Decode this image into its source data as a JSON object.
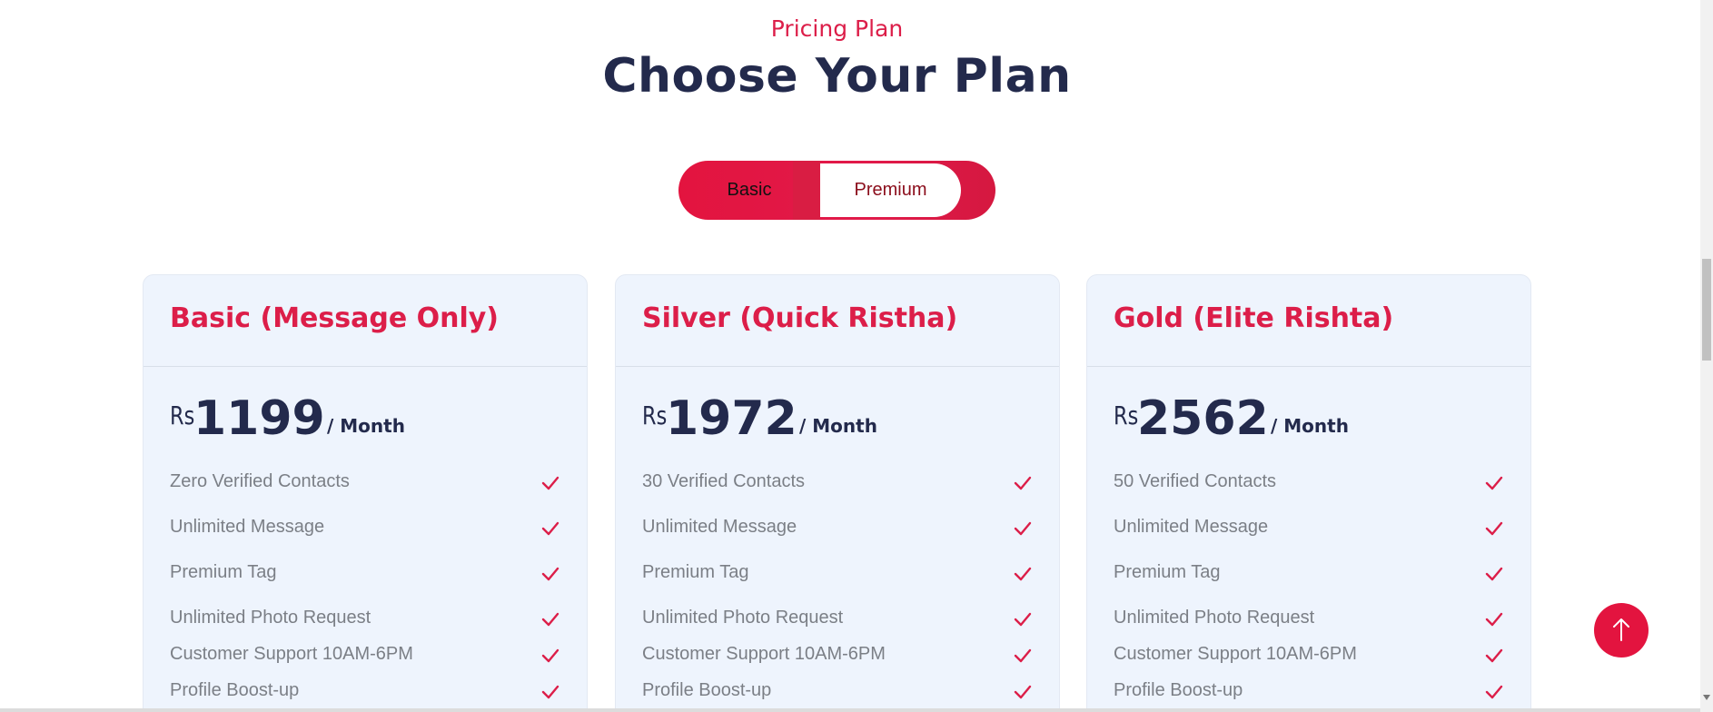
{
  "header": {
    "eyebrow": "Pricing Plan",
    "title": "Choose Your Plan"
  },
  "toggle": {
    "options": [
      "Basic",
      "Premium"
    ],
    "selected": "Premium"
  },
  "plans": [
    {
      "name": "Basic (Message Only)",
      "currency": "Rs",
      "amount": "1199",
      "period": "/ Month",
      "features": [
        "Zero Verified Contacts",
        "Unlimited Message",
        "Premium Tag",
        "Unlimited Photo Request",
        "Customer Support 10AM-6PM",
        "Profile Boost-up"
      ]
    },
    {
      "name": "Silver (Quick Ristha)",
      "currency": "Rs",
      "amount": "1972",
      "period": "/ Month",
      "features": [
        "30 Verified Contacts",
        "Unlimited Message",
        "Premium Tag",
        "Unlimited Photo Request",
        "Customer Support 10AM-6PM",
        "Profile Boost-up"
      ]
    },
    {
      "name": "Gold (Elite Rishta)",
      "currency": "Rs",
      "amount": "2562",
      "period": "/ Month",
      "features": [
        "50 Verified Contacts",
        "Unlimited Message",
        "Premium Tag",
        "Unlimited Photo Request",
        "Customer Support 10AM-6PM",
        "Profile Boost-up"
      ]
    }
  ],
  "colors": {
    "accent": "#dc1e49",
    "heading": "#232a4c",
    "card_bg": "#eef4fd",
    "feature_text": "#7b7f86"
  },
  "icons": {
    "feature_check": "check-icon",
    "scroll_top": "arrow-up-icon"
  }
}
